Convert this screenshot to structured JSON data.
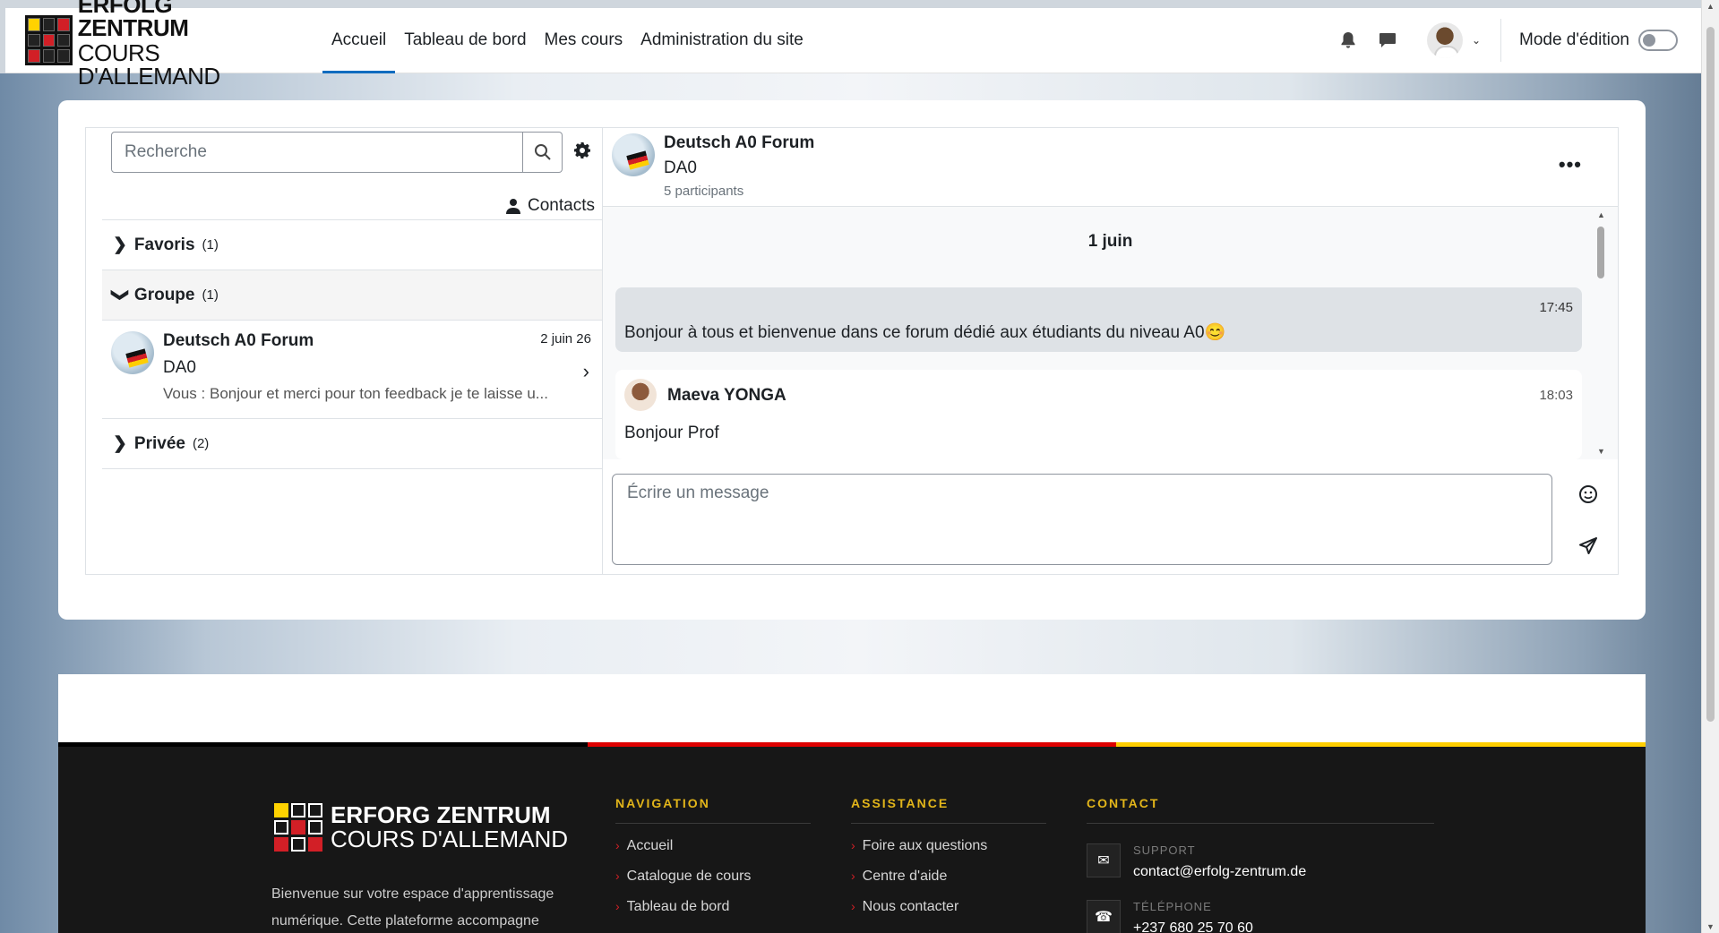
{
  "brand": {
    "line1": "ERFOLG ZENTRUM",
    "line2": "COURS D'ALLEMAND"
  },
  "nav": {
    "links": [
      "Accueil",
      "Tableau de bord",
      "Mes cours",
      "Administration du site"
    ],
    "active": "Accueil",
    "edit_mode_label": "Mode d'édition",
    "edit_mode_on": false
  },
  "messaging": {
    "search_placeholder": "Recherche",
    "contacts_label": "Contacts",
    "sections": {
      "favoris": {
        "label": "Favoris",
        "count": "(1)"
      },
      "groupe": {
        "label": "Groupe",
        "count": "(1)"
      },
      "privee": {
        "label": "Privée",
        "count": "(2)"
      }
    },
    "group_conversation": {
      "title": "Deutsch A0 Forum",
      "subtitle": "DA0",
      "last_message": "Vous : Bonjour et merci pour ton feedback je te laisse u...",
      "date": "2 juin 26"
    },
    "chat": {
      "title": "Deutsch A0 Forum",
      "subtitle": "DA0",
      "participants": "5 participants",
      "day": "1 juin",
      "messages": [
        {
          "time": "17:45",
          "text": "Bonjour à tous et bienvenue dans ce forum dédié aux étudiants du niveau A0😊"
        },
        {
          "author": "Maeva YONGA",
          "time": "18:03",
          "text": "Bonjour Prof"
        }
      ],
      "composer_placeholder": "Écrire un message"
    }
  },
  "footer": {
    "brand_line1": "ERFORG ZENTRUM",
    "brand_line2": "COURS D'ALLEMAND",
    "description": "Bienvenue sur votre espace d'apprentissage numérique. Cette plateforme accompagne",
    "navigation": {
      "title": "NAVIGATION",
      "links": [
        "Accueil",
        "Catalogue de cours",
        "Tableau de bord"
      ]
    },
    "assistance": {
      "title": "ASSISTANCE",
      "links": [
        "Foire aux questions",
        "Centre d'aide",
        "Nous contacter"
      ]
    },
    "contact": {
      "title": "CONTACT",
      "support_label": "SUPPORT",
      "support_value": "contact@erfolg-zentrum.de",
      "phone_label": "TÉLÉPHONE",
      "phone_value": "+237 680 25 70 60"
    },
    "stripe_colors": [
      "#000000",
      "#dd0000",
      "#ffce00"
    ]
  }
}
